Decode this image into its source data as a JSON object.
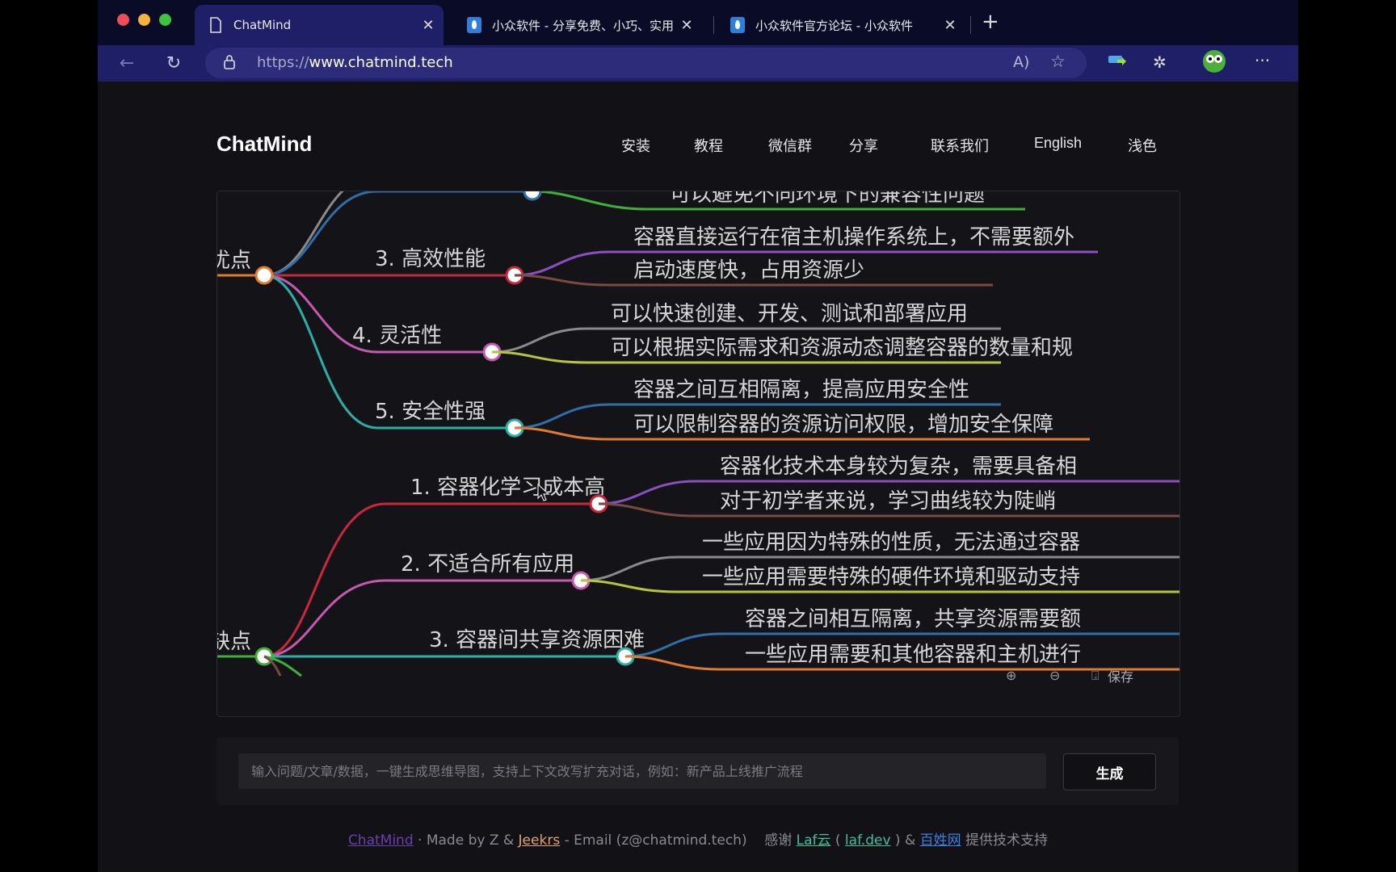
{
  "browser": {
    "tabs": [
      {
        "title": "ChatMind",
        "icon": "document-icon",
        "active": true
      },
      {
        "title": "小众软件 - 分享免费、小巧、实用",
        "icon": "drop-icon",
        "active": false
      },
      {
        "title": "小众软件官方论坛 - 小众软件",
        "icon": "drop-icon",
        "active": false
      }
    ],
    "new_tab_label": "+",
    "close_glyph": "✕",
    "url_scheme": "https://",
    "url_host": "www.chatmind.tech",
    "colors": {
      "tabbar": "#0a0b26",
      "toolbar": "#1f1f68",
      "urlbar": "#2c2c7a"
    }
  },
  "site": {
    "brand": "ChatMind",
    "nav": [
      "安装",
      "教程",
      "微信群",
      "分享",
      "联系我们",
      "English",
      "浅色"
    ]
  },
  "mindmap": {
    "groups": [
      {
        "label": "优点",
        "color": "#e07a2f",
        "children": [
          {
            "label": "",
            "color": "#8a8a8a",
            "children": []
          },
          {
            "label": "",
            "color": "#2f6ea8",
            "children": [
              {
                "label": "可以避免不同环境下的兼容性问题",
                "color": "#3fb03a"
              }
            ]
          },
          {
            "label": "3. 高效性能",
            "color": "#c8283a",
            "children": [
              {
                "label": "容器直接运行在宿主机操作系统上，不需要额外",
                "color": "#8a4fc0"
              },
              {
                "label": "启动速度快，占用资源少",
                "color": "#7a4a42"
              }
            ]
          },
          {
            "label": "4. 灵活性",
            "color": "#c45ab0",
            "children": [
              {
                "label": "可以快速创建、开发、测试和部署应用",
                "color": "#8a8a8a"
              },
              {
                "label": "可以根据实际需求和资源动态调整容器的数量和规",
                "color": "#b8c43a"
              }
            ]
          },
          {
            "label": "5. 安全性强",
            "color": "#2ab0a8",
            "children": [
              {
                "label": "容器之间互相隔离，提高应用安全性",
                "color": "#2f6ea8"
              },
              {
                "label": "可以限制容器的资源访问权限，增加安全保障",
                "color": "#e07a2f"
              }
            ]
          }
        ]
      },
      {
        "label": "缺点",
        "color": "#3fb03a",
        "children": [
          {
            "label": "1. 容器化学习成本高",
            "color": "#c8283a",
            "children": [
              {
                "label": "容器化技术本身较为复杂，需要具备相",
                "color": "#8a4fc0"
              },
              {
                "label": "对于初学者来说，学习曲线较为陡峭",
                "color": "#7a4a42"
              }
            ]
          },
          {
            "label": "2. 不适合所有应用",
            "color": "#c45ab0",
            "children": [
              {
                "label": "一些应用因为特殊的性质，无法通过容器",
                "color": "#8a8a8a"
              },
              {
                "label": "一些应用需要特殊的硬件环境和驱动支持",
                "color": "#b8c43a"
              }
            ]
          },
          {
            "label": "3. 容器间共享资源困难",
            "color": "#2ab0a8",
            "children": [
              {
                "label": "容器之间相互隔离，共享资源需要额",
                "color": "#2f6ea8"
              },
              {
                "label": "一些应用需要和其他容器和主机进行",
                "color": "#e07a2f"
              }
            ]
          }
        ]
      }
    ],
    "controls": {
      "zoom_in": "⊕",
      "zoom_out": "⊖",
      "save_label": "保存"
    }
  },
  "input": {
    "placeholder": "输入问题/文章/数据，一键生成思维导图，支持上下文改写扩充对话，例如：新产品上线推广流程",
    "value": "",
    "generate_label": "生成"
  },
  "footer": {
    "brand_link": "ChatMind",
    "made_by": " · Made by Z & ",
    "author_link": "Jeekrs",
    "email_text": " - Email (z@chatmind.tech)    感谢 ",
    "laf_link": "Laf云",
    "paren_open": " ( ",
    "lafdev_link": "laf.dev",
    "paren_close": " ) & ",
    "baixing_link": "百姓网",
    "support_text": " 提供技术支持",
    "colors": {
      "brand": "#6a3fb0",
      "author": "#e8a070",
      "laf": "#3fc0a0",
      "lafdev": "#3fc0a0",
      "baixing": "#3f7fe0"
    }
  }
}
